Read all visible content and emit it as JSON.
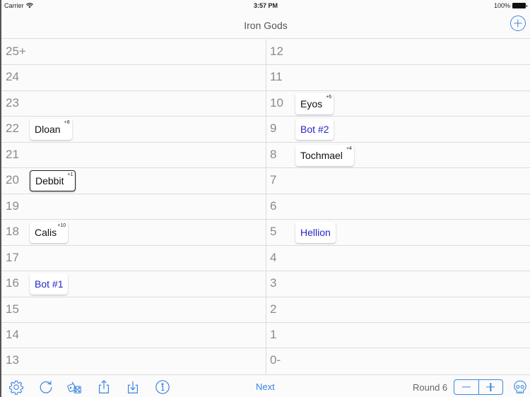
{
  "status_bar": {
    "carrier": "Carrier",
    "time": "3:57 PM",
    "battery": "100%"
  },
  "nav": {
    "title": "Iron Gods",
    "add_icon": "plus-circle-icon"
  },
  "left_column": [
    {
      "num": "25+",
      "chip": null
    },
    {
      "num": "24",
      "chip": null
    },
    {
      "num": "23",
      "chip": null
    },
    {
      "num": "22",
      "chip": {
        "name": "Dloan",
        "mod": "+8",
        "bot": false,
        "active": false
      }
    },
    {
      "num": "21",
      "chip": null
    },
    {
      "num": "20",
      "chip": {
        "name": "Debbit",
        "mod": "+1",
        "bot": false,
        "active": true
      }
    },
    {
      "num": "19",
      "chip": null
    },
    {
      "num": "18",
      "chip": {
        "name": "Calis",
        "mod": "+10",
        "bot": false,
        "active": false
      }
    },
    {
      "num": "17",
      "chip": null
    },
    {
      "num": "16",
      "chip": {
        "name": "Bot #1",
        "mod": "",
        "bot": true,
        "active": false
      }
    },
    {
      "num": "15",
      "chip": null
    },
    {
      "num": "14",
      "chip": null
    },
    {
      "num": "13",
      "chip": null
    }
  ],
  "right_column": [
    {
      "num": "12",
      "chip": null
    },
    {
      "num": "11",
      "chip": null
    },
    {
      "num": "10",
      "chip": {
        "name": "Eyos",
        "mod": "+6",
        "bot": false,
        "active": false
      }
    },
    {
      "num": "9",
      "chip": {
        "name": "Bot #2",
        "mod": "",
        "bot": true,
        "active": false
      }
    },
    {
      "num": "8",
      "chip": {
        "name": "Tochmael",
        "mod": "+4",
        "bot": false,
        "active": false
      }
    },
    {
      "num": "7",
      "chip": null
    },
    {
      "num": "6",
      "chip": null
    },
    {
      "num": "5",
      "chip": {
        "name": "Hellion",
        "mod": "",
        "bot": true,
        "active": false
      }
    },
    {
      "num": "4",
      "chip": null
    },
    {
      "num": "3",
      "chip": null
    },
    {
      "num": "2",
      "chip": null
    },
    {
      "num": "1",
      "chip": null
    },
    {
      "num": "0-",
      "chip": null
    }
  ],
  "toolbar": {
    "icons": [
      "gear-icon",
      "refresh-icon",
      "dice-icon",
      "share-icon",
      "import-icon",
      "info-icon",
      "skull-icon"
    ],
    "next_label": "Next",
    "round_label": "Round 6"
  },
  "colors": {
    "accent": "#3a86e0",
    "bot_text": "#2525c8"
  }
}
